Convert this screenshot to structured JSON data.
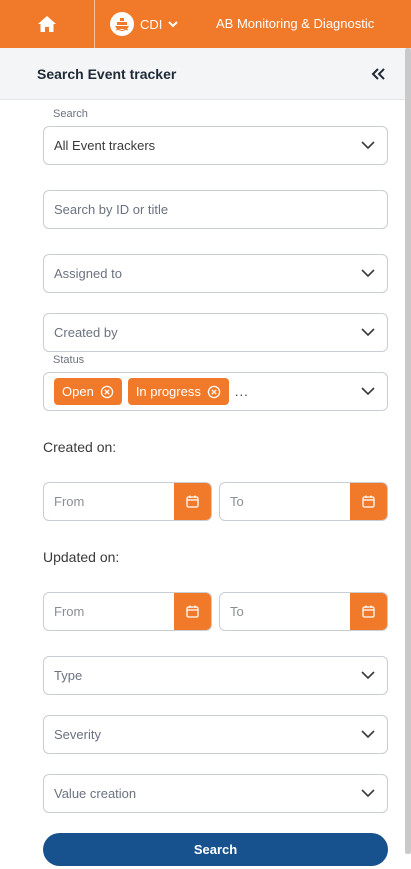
{
  "topbar": {
    "home_icon": "home-icon",
    "vessel_icon": "ship-icon",
    "vessel": "CDI",
    "title": "AB Monitoring & Diagnostic"
  },
  "panel": {
    "title": "Search Event tracker",
    "collapse_icon": "double-chevron-left-icon"
  },
  "form": {
    "search_label": "Search",
    "search_value": "All Event trackers",
    "id_placeholder": "Search by ID or title",
    "assigned_to": "Assigned to",
    "created_by": "Created by",
    "status_label": "Status",
    "status_chips": [
      "Open",
      "In progress"
    ],
    "status_more": "...",
    "created_on_label": "Created on:",
    "updated_on_label": "Updated on:",
    "from_placeholder": "From",
    "to_placeholder": "To",
    "type": "Type",
    "severity": "Severity",
    "value_creation": "Value creation",
    "search_button": "Search"
  },
  "colors": {
    "accent": "#f07a2a",
    "primary_button": "#17528f"
  }
}
